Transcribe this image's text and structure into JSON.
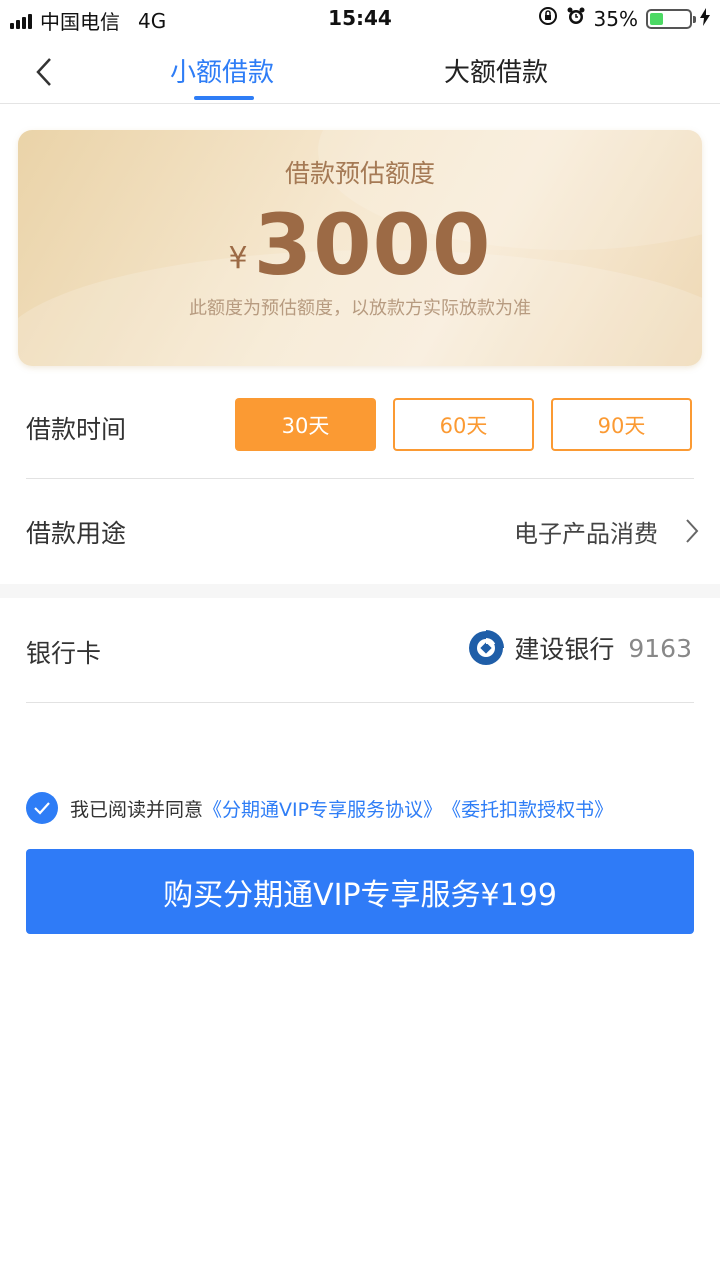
{
  "status_bar": {
    "carrier": "中国电信",
    "network": "4G",
    "time": "15:44",
    "battery_percent_text": "35%",
    "battery_level": 0.35,
    "icons": [
      "signal-icon",
      "rotation-lock-icon",
      "alarm-icon",
      "battery-icon",
      "charging-icon"
    ]
  },
  "nav": {
    "tabs": [
      {
        "label": "小额借款",
        "active": true
      },
      {
        "label": "大额借款",
        "active": false
      }
    ],
    "accent_color": "#2e7df6"
  },
  "quota_card": {
    "title": "借款预估额度",
    "currency": "¥",
    "amount": "3000",
    "note": "此额度为预估额度，以放款方实际放款为准"
  },
  "loan_time": {
    "label": "借款时间",
    "options": [
      {
        "label": "30天",
        "selected": true
      },
      {
        "label": "60天",
        "selected": false
      },
      {
        "label": "90天",
        "selected": false
      }
    ],
    "accent_color": "#fb9a33"
  },
  "loan_purpose": {
    "label": "借款用途",
    "value": "电子产品消费"
  },
  "bank_card": {
    "label": "银行卡",
    "bank_name": "建设银行",
    "card_tail": "9163",
    "logo_icon": "ccb-logo-icon"
  },
  "agreement": {
    "checked": true,
    "prefix": "我已阅读并同意",
    "link1": "《分期通VIP专享服务协议》",
    "link2": "《委托扣款授权书》"
  },
  "buy_button": {
    "label": "购买分期通VIP专享服务¥199",
    "color": "#2f7bf7"
  }
}
